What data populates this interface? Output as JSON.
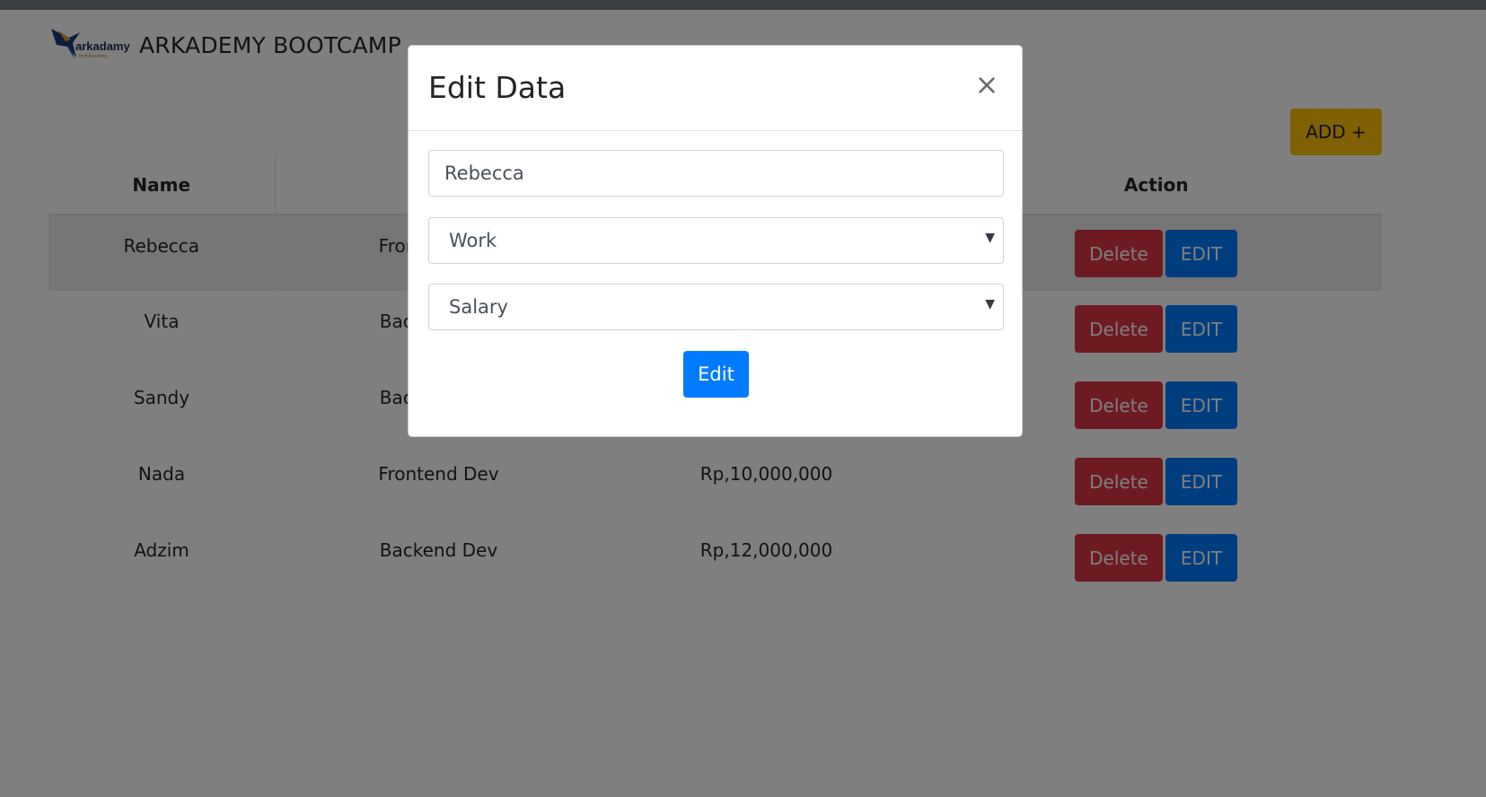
{
  "header": {
    "logo_text": "arkadamy",
    "logo_sub": "Tech Academy",
    "title": "ARKADEMY BOOTCAMP"
  },
  "toolbar": {
    "add_label": "ADD +"
  },
  "table": {
    "headers": [
      "Name",
      "",
      "",
      "Action"
    ],
    "rows": [
      {
        "name": "Rebecca",
        "work": "Frontend Dev",
        "salary": ""
      },
      {
        "name": "Vita",
        "work": "Backend Dev",
        "salary": ""
      },
      {
        "name": "Sandy",
        "work": "Backend Dev",
        "salary": ""
      },
      {
        "name": "Nada",
        "work": "Frontend Dev",
        "salary": "Rp,10,000,000"
      },
      {
        "name": "Adzim",
        "work": "Backend Dev",
        "salary": "Rp,12,000,000"
      }
    ],
    "delete_label": "Delete",
    "edit_label": "EDIT"
  },
  "modal": {
    "title": "Edit Data",
    "close_label": "×",
    "name_value": "Rebecca",
    "work_value": "Work",
    "salary_value": "Salary",
    "submit_label": "Edit"
  },
  "colors": {
    "add": "#ffc107",
    "delete": "#dc3545",
    "edit": "#007bff",
    "backdrop": "rgba(0,0,0,0.5)"
  }
}
